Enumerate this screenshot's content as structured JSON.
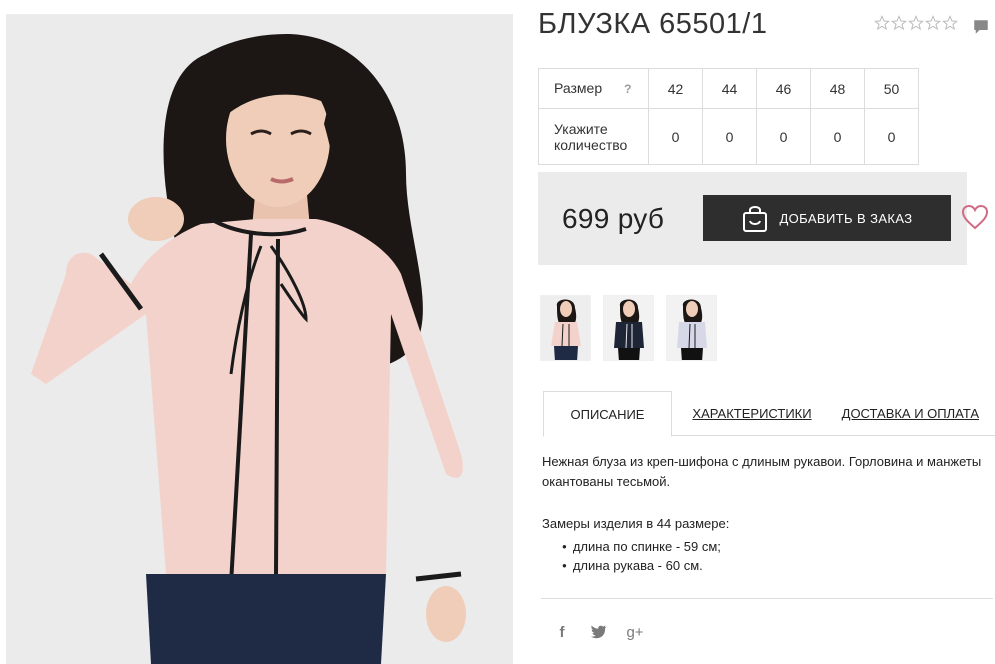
{
  "product": {
    "title": "БЛУЗКА 65501/1",
    "rating_stars": 5,
    "rating_filled": 0,
    "price": "699 руб",
    "add_to_cart_label": "ДОБАВИТЬ В ЗАКАЗ",
    "colors": {
      "accent": "#2e2e2e",
      "heart": "#d16b85",
      "panel": "#ebebeb",
      "blouse": "#f4d2cc"
    }
  },
  "sizes": {
    "size_label": "Размер",
    "help_mark": "?",
    "qty_label_line1": "Укажите",
    "qty_label_line2": "количество",
    "values": [
      "42",
      "44",
      "46",
      "48",
      "50"
    ],
    "quantities": [
      "0",
      "0",
      "0",
      "0",
      "0"
    ]
  },
  "tabs": [
    {
      "label": "ОПИСАНИЕ",
      "active": true
    },
    {
      "label": "ХАРАКТЕРИСТИКИ",
      "active": false
    },
    {
      "label": "ДОСТАВКА И ОПЛАТА",
      "active": false
    }
  ],
  "description": {
    "text": "Нежная блуза из креп-шифона с длиным рукавои. Горловина и манжеты окантованы тесьмой.",
    "measure_title": "Замеры изделия в 44 размере:",
    "measures": [
      "длина по спинке - 59 см;",
      "длина рукава - 60 см."
    ]
  },
  "social": {
    "facebook": "f",
    "google_plus": "g+"
  },
  "icons": [
    "star-icon",
    "comment-icon",
    "shopping-bag-icon",
    "heart-icon",
    "facebook-icon",
    "twitter-icon",
    "google-plus-icon"
  ]
}
